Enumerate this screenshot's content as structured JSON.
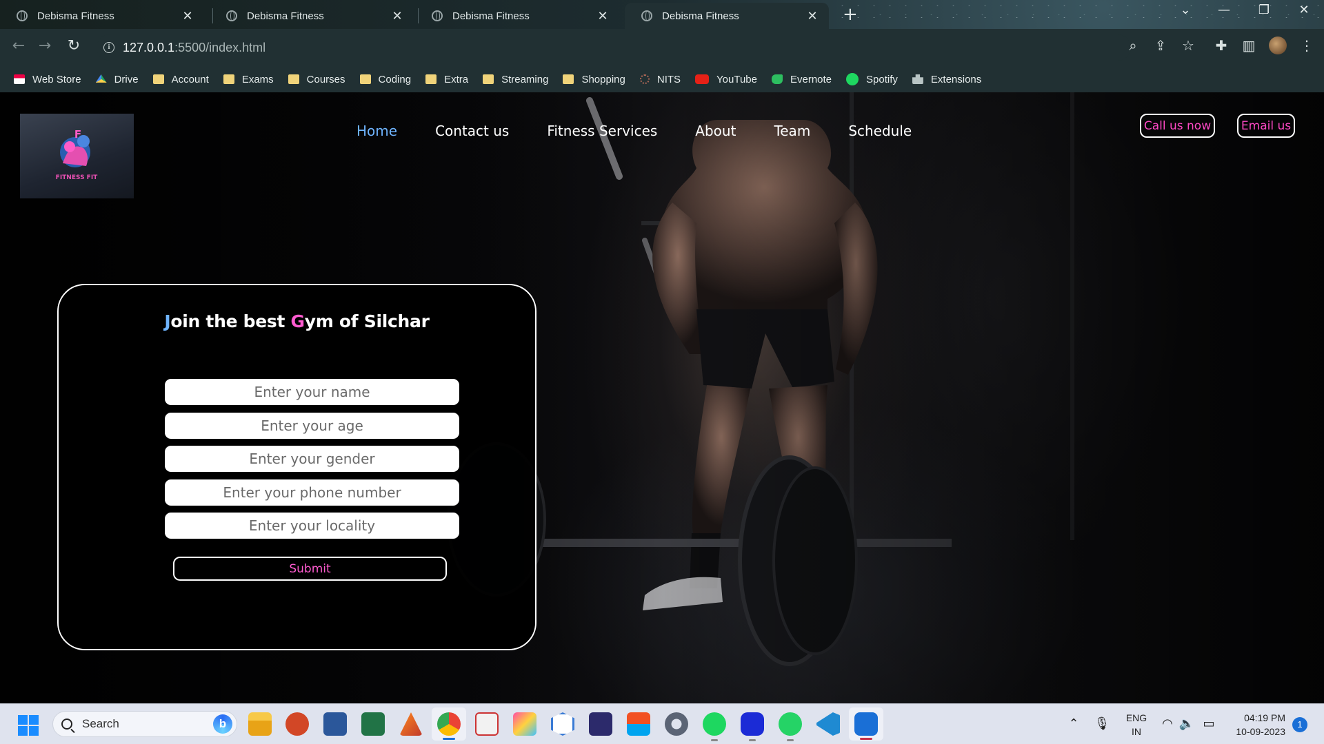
{
  "browser": {
    "tabs": [
      {
        "title": "Debisma Fitness",
        "active": false
      },
      {
        "title": "Debisma Fitness",
        "active": false
      },
      {
        "title": "Debisma Fitness",
        "active": false
      },
      {
        "title": "Debisma Fitness",
        "active": true
      }
    ],
    "url_host": "127.0.0.1",
    "url_path": ":5500/index.html",
    "bookmarks": [
      {
        "label": "Web Store",
        "icon": "store-icon"
      },
      {
        "label": "Drive",
        "icon": "drive-icon"
      },
      {
        "label": "Account",
        "icon": "folder-icon"
      },
      {
        "label": "Exams",
        "icon": "folder-icon"
      },
      {
        "label": "Courses",
        "icon": "folder-icon"
      },
      {
        "label": "Coding",
        "icon": "folder-icon"
      },
      {
        "label": "Extra",
        "icon": "folder-icon"
      },
      {
        "label": "Streaming",
        "icon": "folder-icon"
      },
      {
        "label": "Shopping",
        "icon": "folder-icon"
      },
      {
        "label": "NITS",
        "icon": "nits-icon"
      },
      {
        "label": "YouTube",
        "icon": "youtube-icon"
      },
      {
        "label": "Evernote",
        "icon": "evernote-icon"
      },
      {
        "label": "Spotify",
        "icon": "spotify-icon"
      },
      {
        "label": "Extensions",
        "icon": "puzzle-icon"
      }
    ]
  },
  "site": {
    "logo_text": "FITNESS FIT",
    "logo_letter": "F",
    "nav": [
      "Home",
      "Contact us",
      "Fitness Services",
      "About",
      "Team",
      "Schedule"
    ],
    "active_nav": "Home",
    "call_label": "Call us now",
    "email_label": "Email us",
    "form": {
      "title_j": "J",
      "title_a": "oin the best ",
      "title_g": "G",
      "title_b": "ym of Silchar",
      "name_placeholder": "Enter your name",
      "age_placeholder": "Enter your age",
      "gender_placeholder": "Enter your gender",
      "phone_placeholder": "Enter your phone number",
      "locality_placeholder": "Enter your locality",
      "submit_label": "Submit"
    },
    "colors": {
      "nav_active": "#6fb4ff",
      "accent_pink": "#ff49c6"
    }
  },
  "taskbar": {
    "search_label": "Search",
    "bing_label": "b",
    "lang_line1": "ENG",
    "lang_line2": "IN",
    "time": "04:19 PM",
    "date": "10-09-2023",
    "notifications": "1"
  }
}
